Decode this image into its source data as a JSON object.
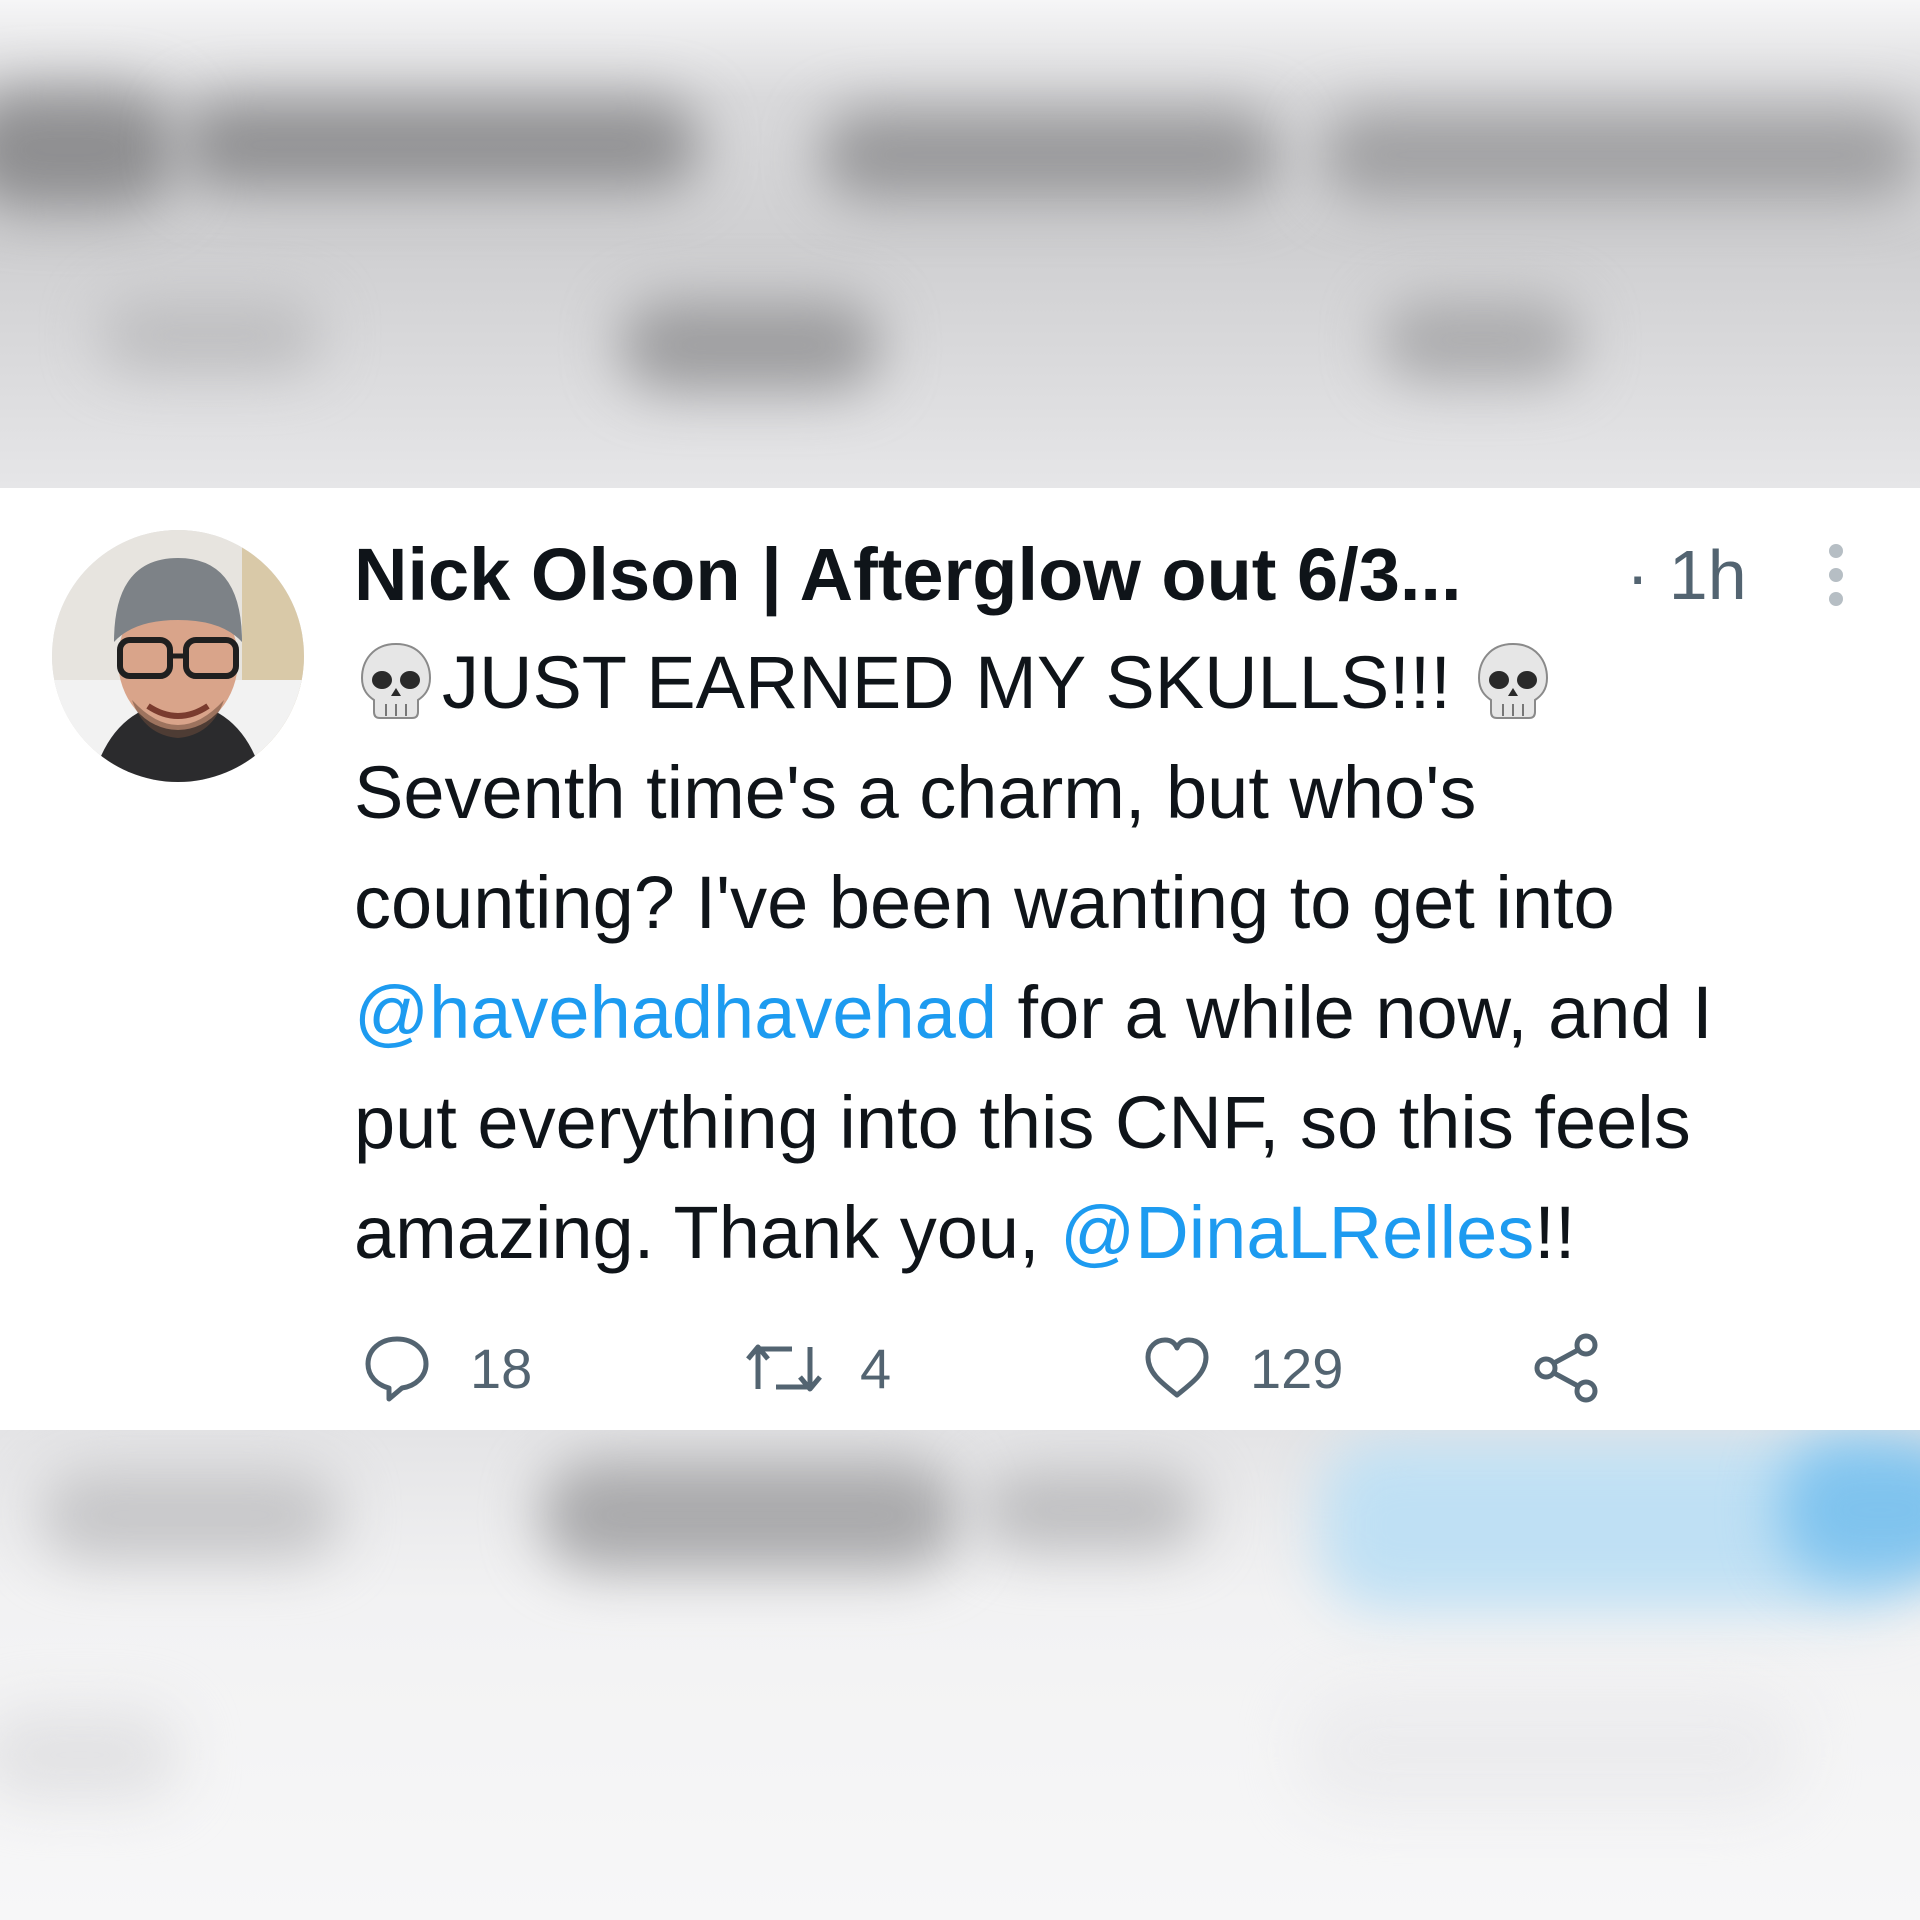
{
  "tweet": {
    "author_name": "Nick Olson | Afterglow out 6/3...",
    "separator": "·",
    "time": "1h",
    "body": {
      "line1_text": "JUST EARNED MY SKULLS!!!",
      "line2": "Seventh time's a charm, but who's",
      "line3": "counting? I've been wanting to get into",
      "line4_mention": "@havehadhavehad",
      "line4_rest": " for a while now, and I",
      "line5": "put everything into this CNF, so this feels",
      "line6_pre": "amazing. Thank you, ",
      "line6_mention": "@DinaLRelles",
      "line6_post": "!!"
    },
    "icons": {
      "leading_emoji": "skull-emoji",
      "trailing_emoji": "skull-emoji",
      "avatar": "profile-photo"
    },
    "actions": {
      "replies": "18",
      "retweets": "4",
      "likes": "129"
    }
  },
  "colors": {
    "mention": "#1d9bf0",
    "text": "#0f1419",
    "secondary": "#536471",
    "card_background": "#ffffff"
  }
}
